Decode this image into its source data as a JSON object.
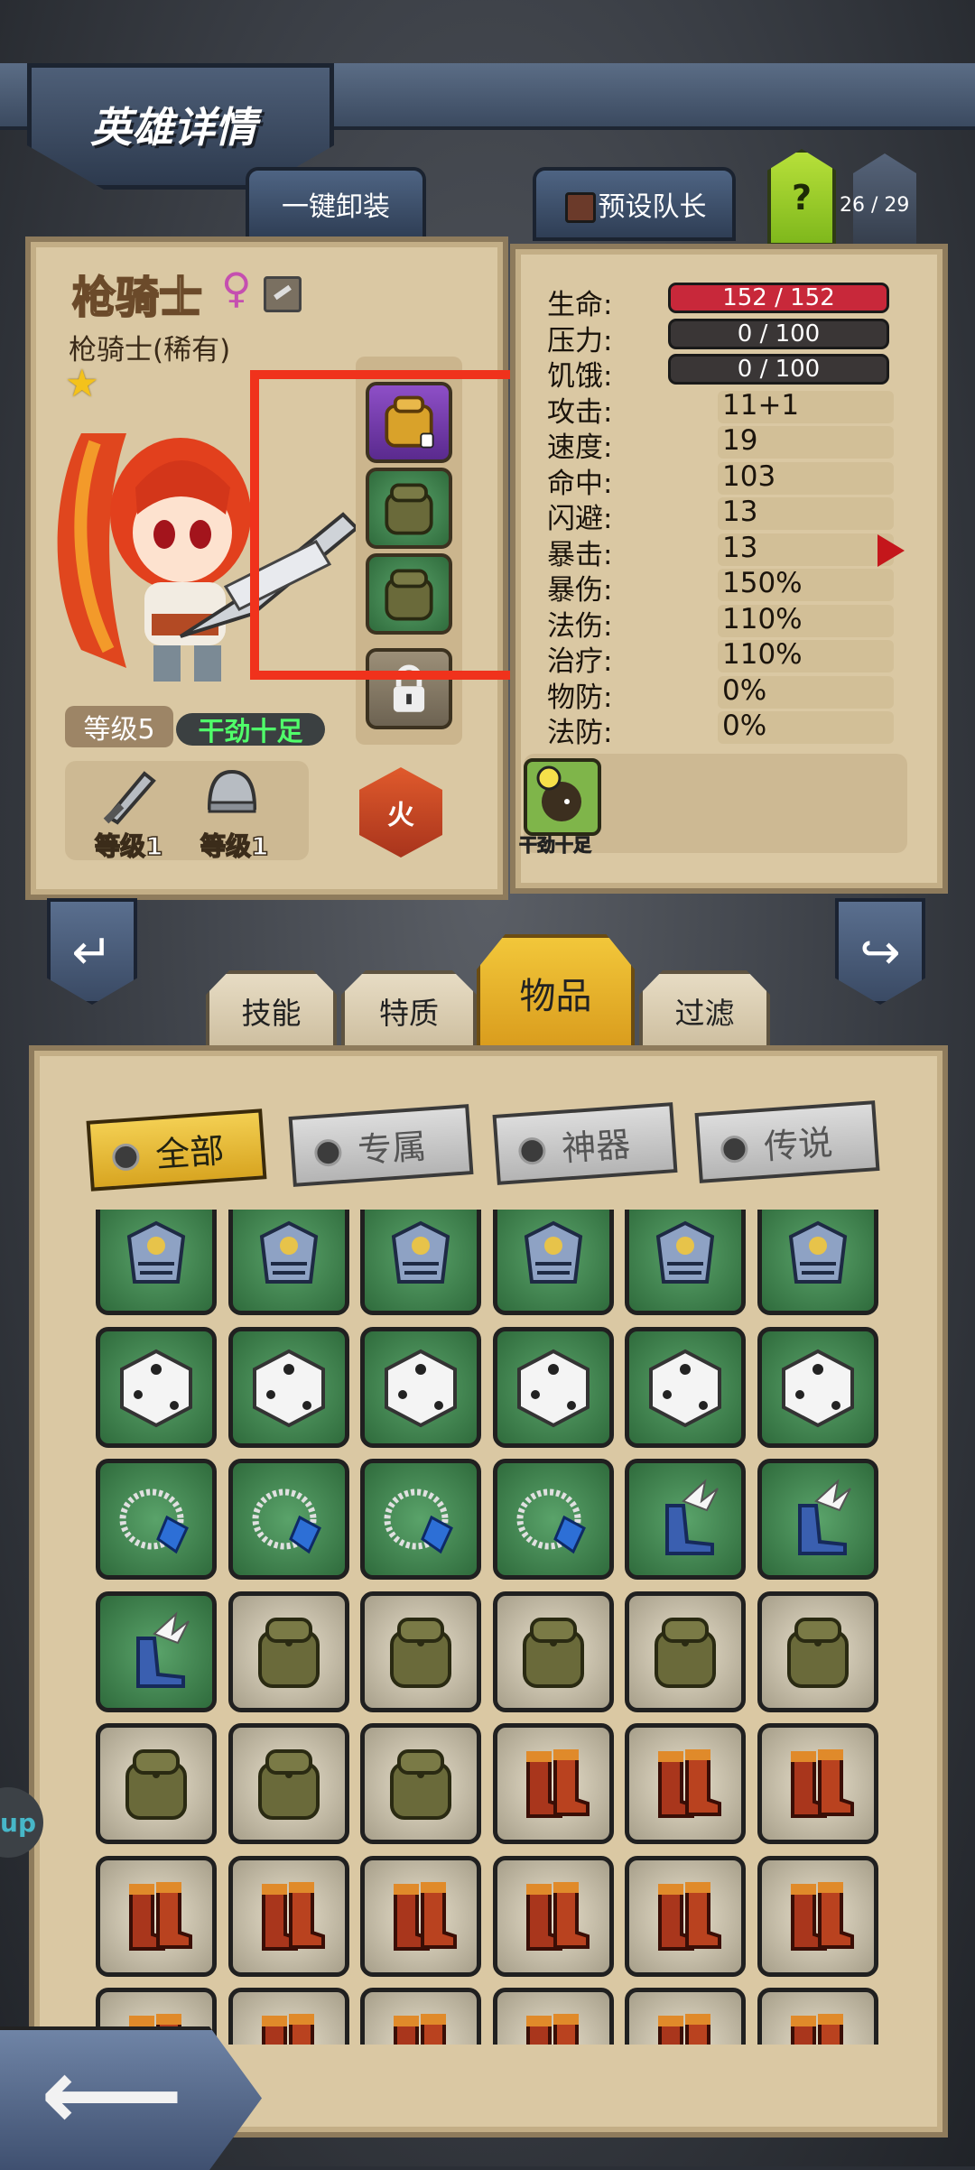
{
  "header": {
    "title": "英雄详情"
  },
  "top_buttons": {
    "unequip_all": "一键卸装",
    "preset_leader": "预设队长",
    "help": "?",
    "roster_count": "26 / 29"
  },
  "hero": {
    "name": "枪骑士",
    "gender_symbol": "♀",
    "class": "枪骑士(稀有)",
    "stars": "★",
    "level": "等级5",
    "trait": "干劲十足",
    "element": "火"
  },
  "gear": {
    "weapon_level": "等级1",
    "armor_level": "等级1"
  },
  "stats": [
    {
      "label": "生命:",
      "value": "152 / 152",
      "type": "bar",
      "color": "#c8283a"
    },
    {
      "label": "压力:",
      "value": "0 / 100",
      "type": "bar",
      "color": "#3a3636"
    },
    {
      "label": "饥饿:",
      "value": "0 / 100",
      "type": "bar",
      "color": "#3a3636"
    },
    {
      "label": "攻击:",
      "value": "11+1"
    },
    {
      "label": "速度:",
      "value": "19"
    },
    {
      "label": "命中:",
      "value": "103"
    },
    {
      "label": "闪避:",
      "value": "13"
    },
    {
      "label": "暴击:",
      "value": "13"
    },
    {
      "label": "暴伤:",
      "value": "150%"
    },
    {
      "label": "法伤:",
      "value": "110%"
    },
    {
      "label": "治疗:",
      "value": "110%"
    },
    {
      "label": "物防:",
      "value": "0%"
    },
    {
      "label": "法防:",
      "value": "0%"
    }
  ],
  "trait_card": {
    "caption": "干劲十足"
  },
  "tabs": [
    {
      "label": "技能",
      "active": false
    },
    {
      "label": "特质",
      "active": false
    },
    {
      "label": "物品",
      "active": true
    },
    {
      "label": "过滤",
      "active": false
    }
  ],
  "filters": [
    {
      "label": "全部",
      "active": true
    },
    {
      "label": "专属",
      "active": false
    },
    {
      "label": "神器",
      "active": false
    },
    {
      "label": "传说",
      "active": false
    }
  ],
  "inventory_rows": [
    [
      "armor-icon",
      "armor-icon",
      "armor-icon",
      "armor-icon",
      "armor-icon",
      "armor-icon"
    ],
    [
      "dice-icon",
      "dice-icon",
      "dice-icon",
      "dice-icon",
      "dice-icon",
      "dice-icon"
    ],
    [
      "amulet-icon",
      "amulet-icon",
      "amulet-icon",
      "amulet-icon",
      "winged-boots-icon",
      "winged-boots-icon"
    ],
    [
      "winged-boots-icon",
      "backpack-icon",
      "backpack-icon",
      "backpack-icon",
      "backpack-icon",
      "backpack-icon"
    ],
    [
      "backpack-icon",
      "backpack-icon",
      "backpack-icon",
      "red-boots-icon",
      "red-boots-icon",
      "red-boots-icon"
    ],
    [
      "red-boots-icon",
      "red-boots-icon",
      "red-boots-icon",
      "red-boots-icon",
      "red-boots-icon",
      "red-boots-icon"
    ],
    [
      "red-boots-icon",
      "red-boots-icon",
      "red-boots-icon",
      "red-boots-icon",
      "red-boots-icon",
      "red-boots-icon"
    ]
  ],
  "side_bubble": "up",
  "colors": {
    "paper": "#dac8a3",
    "accent_gold": "#f2c73a",
    "highlight_red": "#f0321c"
  }
}
